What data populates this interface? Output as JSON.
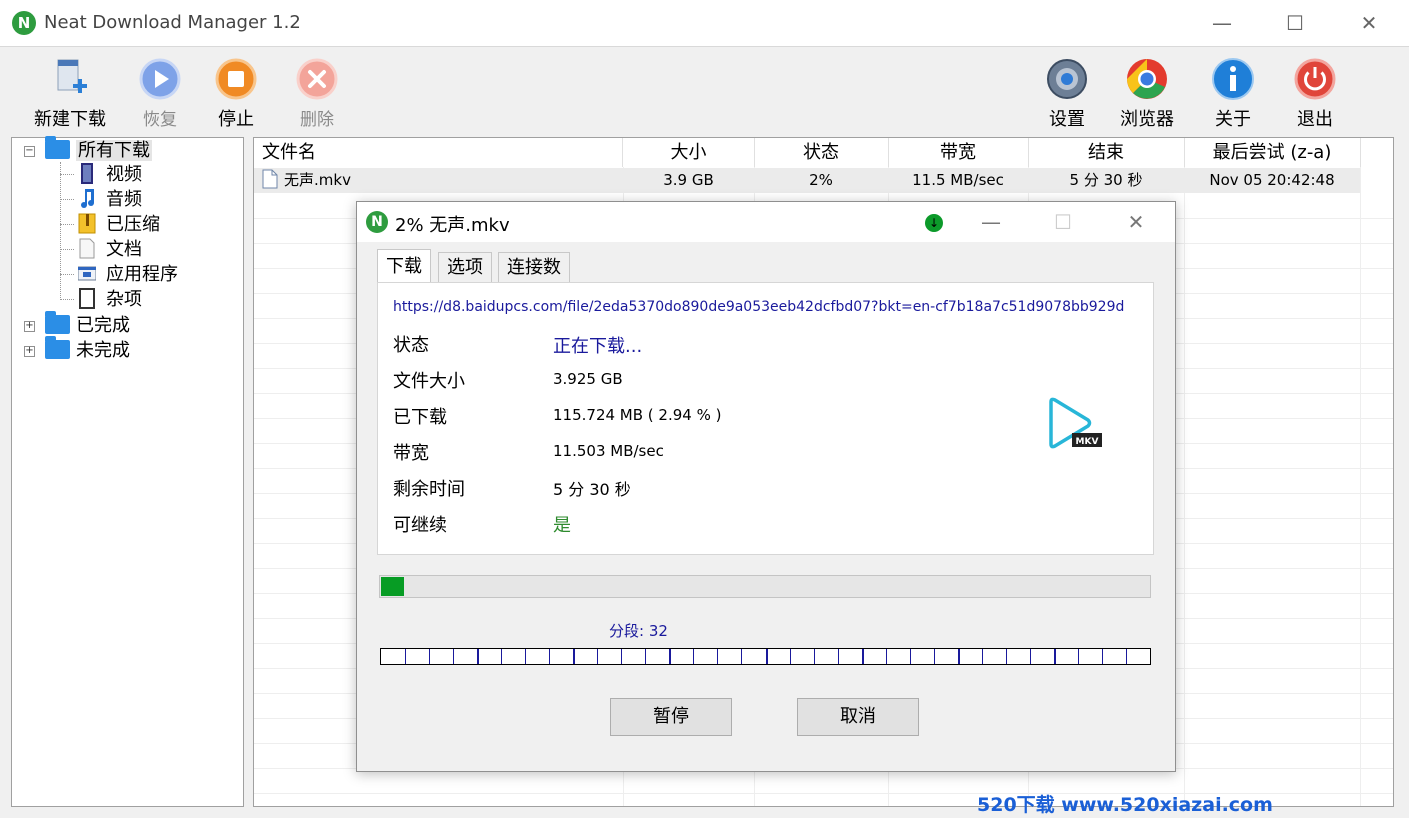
{
  "window": {
    "title": "Neat Download Manager 1.2",
    "logo_letter": "N",
    "min": "—",
    "max": "☐",
    "close": "✕"
  },
  "toolbar": {
    "new_download": "新建下载",
    "resume": "恢复",
    "stop": "停止",
    "delete": "删除",
    "settings": "设置",
    "browser": "浏览器",
    "about": "关于",
    "exit": "退出"
  },
  "tree": {
    "all": "所有下载",
    "video": "视频",
    "audio": "音频",
    "compressed": "已压缩",
    "documents": "文档",
    "programs": "应用程序",
    "misc": "杂项",
    "completed": "已完成",
    "incomplete": "未完成",
    "expand": "+",
    "collapse": "−"
  },
  "list": {
    "columns": [
      "文件名",
      "大小",
      "状态",
      "带宽",
      "结束",
      "最后尝试 (z-a)"
    ],
    "rows": [
      {
        "name": "无声.mkv",
        "size": "3.9 GB",
        "status": "2%",
        "bandwidth": "11.5 MB/sec",
        "eta": "5 分  30 秒",
        "last": "Nov 05  20:42:48"
      }
    ]
  },
  "dialog": {
    "title": "2%  无声.mkv",
    "logo_letter": "N",
    "status_icon": "↓",
    "min": "—",
    "max": "☐",
    "close": "✕",
    "tabs": [
      "下载",
      "选项",
      "连接数"
    ],
    "url": "https://d8.baidupcs.com/file/2eda5370do890de9a053eeb42dcfbd07?bkt=en-cf7b18a7c51d9078bb929d",
    "fields": {
      "status_label": "状态",
      "status_value": "正在下载...",
      "size_label": "文件大小",
      "size_value": "3.925 GB",
      "downloaded_label": "已下载",
      "downloaded_value": "115.724 MB ( 2.94 % )",
      "bandwidth_label": "带宽",
      "bandwidth_value": "11.503 MB/sec",
      "remaining_label": "剩余时间",
      "remaining_value": "5 分  30 秒",
      "resumable_label": "可继续",
      "resumable_value": "是"
    },
    "file_badge": "MKV",
    "progress_fraction": 0.0294,
    "segments_label": "分段: 32",
    "segments": 32,
    "pause_button": "暂停",
    "cancel_button": "取消"
  },
  "watermark": "520下载 www.520xiazai.com",
  "colors": {
    "accent_green": "#079c24",
    "link_blue": "#1a1a9c",
    "folder_blue": "#2b8ee6",
    "resumable_green": "#2e8b2e"
  }
}
